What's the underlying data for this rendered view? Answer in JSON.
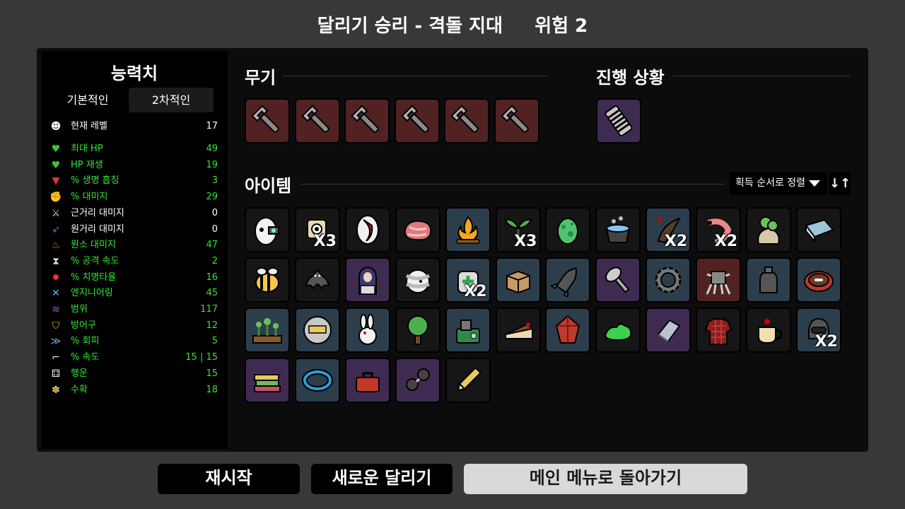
{
  "header": {
    "title": "달리기 승리 - 격돌 지대     위험 2"
  },
  "stats": {
    "title": "능력치",
    "tabs": [
      "기본적인",
      "2차적인"
    ],
    "rows": [
      {
        "icon": "brain-icon",
        "glyph": "☻",
        "label": "현재 레벨",
        "value": "17",
        "color": "#ffffff"
      },
      {
        "icon": "heart-icon",
        "glyph": "♥",
        "label": "최대 HP",
        "value": "49",
        "color": "#33e533"
      },
      {
        "icon": "heart-plus-icon",
        "glyph": "♥",
        "label": "HP 재생",
        "value": "19",
        "color": "#33e533"
      },
      {
        "icon": "fang-icon",
        "glyph": "▼",
        "label": "% 생명 흡칭",
        "value": "3",
        "color": "#33e533"
      },
      {
        "icon": "arm-icon",
        "glyph": "✊",
        "label": "% 대미지",
        "value": "29",
        "color": "#33e533"
      },
      {
        "icon": "sword-icon",
        "glyph": "⚔",
        "label": "근거리 대미지",
        "value": "0",
        "color": "#ffffff"
      },
      {
        "icon": "bow-icon",
        "glyph": "➶",
        "label": "원거리 대미지",
        "value": "0",
        "color": "#ffffff"
      },
      {
        "icon": "flame-icon",
        "glyph": "♨",
        "label": "원소 대미지",
        "value": "47",
        "color": "#33e533"
      },
      {
        "icon": "hourglass-icon",
        "glyph": "⧗",
        "label": "% 공격 속도",
        "value": "2",
        "color": "#33e533"
      },
      {
        "icon": "crit-icon",
        "glyph": "✸",
        "label": "% 치명타율",
        "value": "16",
        "color": "#33e533"
      },
      {
        "icon": "wrench-icon",
        "glyph": "✕",
        "label": "엔지니어링",
        "value": "45",
        "color": "#33e533"
      },
      {
        "icon": "range-icon",
        "glyph": "≋",
        "label": "범위",
        "value": "117",
        "color": "#33e533"
      },
      {
        "icon": "shield-icon",
        "glyph": "⛉",
        "label": "방어구",
        "value": "12",
        "color": "#33e533"
      },
      {
        "icon": "dodge-icon",
        "glyph": "≫",
        "label": "% 회피",
        "value": "5",
        "color": "#33e533"
      },
      {
        "icon": "boot-icon",
        "glyph": "⌐",
        "label": "% 속도",
        "value": "15 | 15",
        "color": "#33e533"
      },
      {
        "icon": "dice-icon",
        "glyph": "⚃",
        "label": "행운",
        "value": "15",
        "color": "#33e533"
      },
      {
        "icon": "wheat-icon",
        "glyph": "✽",
        "label": "수확",
        "value": "18",
        "color": "#33e533"
      }
    ]
  },
  "weapons": {
    "title": "무기",
    "items": [
      {
        "icon": "wrench-icon",
        "tier": "red"
      },
      {
        "icon": "wrench-icon",
        "tier": "red"
      },
      {
        "icon": "wrench-icon",
        "tier": "red"
      },
      {
        "icon": "wrench-icon",
        "tier": "red"
      },
      {
        "icon": "wrench-icon",
        "tier": "red"
      },
      {
        "icon": "wrench-icon",
        "tier": "red"
      }
    ]
  },
  "progress": {
    "title": "진행 상황",
    "items": [
      {
        "icon": "spring-coil-icon",
        "tier": "purple"
      }
    ]
  },
  "items": {
    "title": "아이템",
    "sort_label": "획득 순서로 정렬",
    "sort_direction_glyph": "↓↑",
    "list": [
      {
        "icon": "cyborg-egg-icon",
        "tier": "dark",
        "count": ""
      },
      {
        "icon": "camera-icon",
        "tier": "dark",
        "count": "X3"
      },
      {
        "icon": "cut-mouth-icon",
        "tier": "dark",
        "count": ""
      },
      {
        "icon": "steak-icon",
        "tier": "dark",
        "count": ""
      },
      {
        "icon": "campfire-icon",
        "tier": "blue",
        "count": ""
      },
      {
        "icon": "sprout-icon",
        "tier": "dark",
        "count": "X3"
      },
      {
        "icon": "green-egg-icon",
        "tier": "dark",
        "count": ""
      },
      {
        "icon": "bubbling-pot-icon",
        "tier": "dark",
        "count": ""
      },
      {
        "icon": "blood-horn-icon",
        "tier": "blue",
        "count": "X2"
      },
      {
        "icon": "shrimp-icon",
        "tier": "dark",
        "count": "X2"
      },
      {
        "icon": "herb-sack-icon",
        "tier": "dark",
        "count": ""
      },
      {
        "icon": "blue-book-icon",
        "tier": "dark",
        "count": ""
      },
      {
        "icon": "bee-icon",
        "tier": "dark",
        "count": ""
      },
      {
        "icon": "bat-icon",
        "tier": "dark",
        "count": ""
      },
      {
        "icon": "hooded-figure-icon",
        "tier": "purple",
        "count": ""
      },
      {
        "icon": "bandaged-head-icon",
        "tier": "dark",
        "count": ""
      },
      {
        "icon": "medkit-icon",
        "tier": "blue",
        "count": "X2"
      },
      {
        "icon": "cardboard-box-icon",
        "tier": "blue",
        "count": ""
      },
      {
        "icon": "missile-icon",
        "tier": "blue",
        "count": ""
      },
      {
        "icon": "bolt-icon",
        "tier": "purple",
        "count": ""
      },
      {
        "icon": "gear-ring-icon",
        "tier": "blue",
        "count": ""
      },
      {
        "icon": "robot-walker-icon",
        "tier": "red",
        "count": ""
      },
      {
        "icon": "bottle-icon",
        "tier": "blue",
        "count": ""
      },
      {
        "icon": "pet-bowl-icon",
        "tier": "blue",
        "count": ""
      },
      {
        "icon": "garden-bed-icon",
        "tier": "blue",
        "count": ""
      },
      {
        "icon": "metal-sphere-icon",
        "tier": "blue",
        "count": ""
      },
      {
        "icon": "rabbit-icon",
        "tier": "blue",
        "count": ""
      },
      {
        "icon": "tree-icon",
        "tier": "dark",
        "count": ""
      },
      {
        "icon": "machine-icon",
        "tier": "blue",
        "count": ""
      },
      {
        "icon": "cake-slice-icon",
        "tier": "dark",
        "count": ""
      },
      {
        "icon": "red-crystal-icon",
        "tier": "blue",
        "count": ""
      },
      {
        "icon": "green-slime-icon",
        "tier": "dark",
        "count": ""
      },
      {
        "icon": "metal-plate-icon",
        "tier": "purple",
        "count": ""
      },
      {
        "icon": "plaid-shirt-icon",
        "tier": "dark",
        "count": ""
      },
      {
        "icon": "coffee-cup-icon",
        "tier": "dark",
        "count": ""
      },
      {
        "icon": "helmet-icon",
        "tier": "blue",
        "count": "X2"
      },
      {
        "icon": "book-stack-icon",
        "tier": "purple",
        "count": ""
      },
      {
        "icon": "bracelet-icon",
        "tier": "blue",
        "count": ""
      },
      {
        "icon": "toolbox-icon",
        "tier": "purple",
        "count": ""
      },
      {
        "icon": "goggles-icon",
        "tier": "purple",
        "count": ""
      },
      {
        "icon": "pencil-icon",
        "tier": "dark",
        "count": ""
      }
    ]
  },
  "tier_colors": {
    "dark": "#161616",
    "blue": "#2c3e4c",
    "purple": "#3f2b52",
    "red": "#522222"
  },
  "footer": {
    "restart": "재시작",
    "new_run": "새로운 달리기",
    "main_menu": "메인 메뉴로 돌아가기"
  }
}
